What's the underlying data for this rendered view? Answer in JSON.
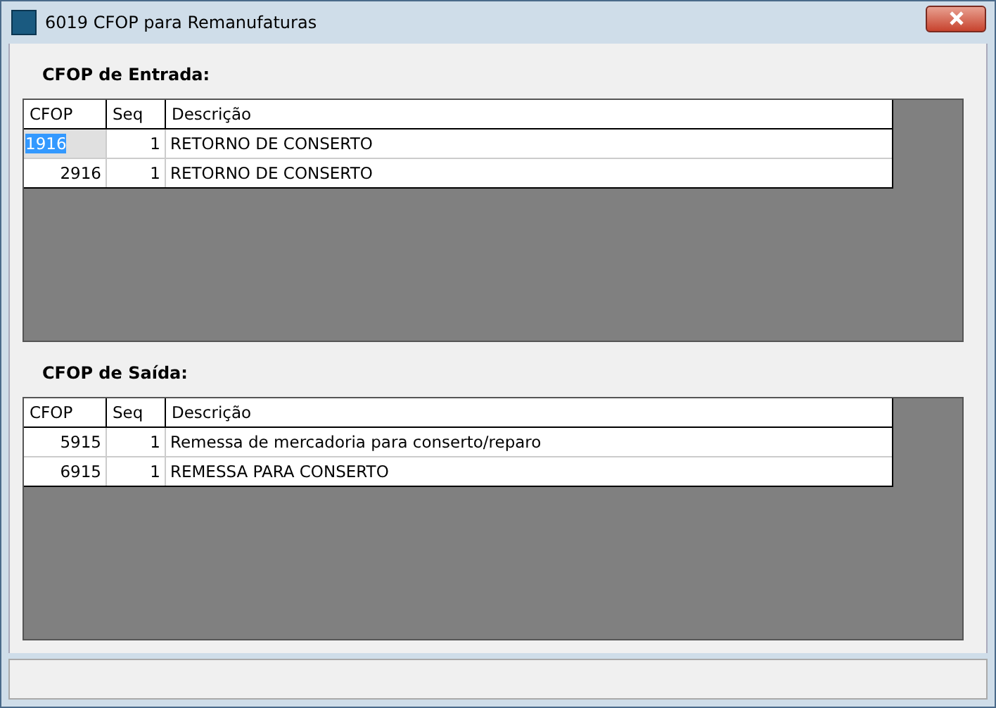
{
  "window": {
    "title": "6019 CFOP para Remanufaturas"
  },
  "sections": [
    {
      "label": "CFOP de Entrada:",
      "columns": [
        "CFOP",
        "Seq",
        "Descrição"
      ],
      "rows": [
        {
          "cells": [
            "1916",
            "1",
            "RETORNO DE CONSERTO"
          ],
          "selected": true
        },
        {
          "cells": [
            "2916",
            "1",
            "RETORNO DE CONSERTO"
          ],
          "selected": false
        }
      ]
    },
    {
      "label": "CFOP de Saída:",
      "columns": [
        "CFOP",
        "Seq",
        "Descrição"
      ],
      "rows": [
        {
          "cells": [
            "5915",
            "1",
            "Remessa de mercadoria para conserto/reparo"
          ],
          "selected": false
        },
        {
          "cells": [
            "6915",
            "1",
            "REMESSA PARA CONSERTO"
          ],
          "selected": false
        }
      ]
    }
  ]
}
